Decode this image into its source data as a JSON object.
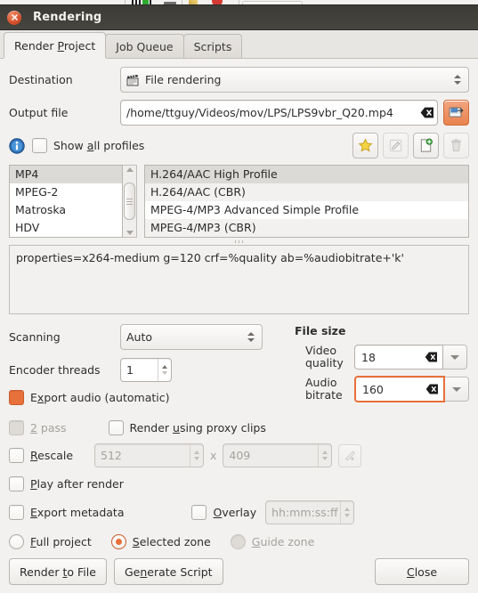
{
  "window": {
    "title": "Rendering",
    "close_icon": "close-icon"
  },
  "tabs": [
    {
      "label": "Render Project",
      "mnemonic": "P",
      "active": true
    },
    {
      "label": "Job Queue",
      "mnemonic": "J",
      "active": false
    },
    {
      "label": "Scripts",
      "mnemonic": "",
      "active": false
    }
  ],
  "destination": {
    "label": "Destination",
    "icon": "clapperboard-icon",
    "value": "File rendering"
  },
  "output_file": {
    "label": "Output file",
    "value": "/home/ttguy/Videos/mov/LPS/LPS9vbr_Q20.mp4",
    "clear_icon": "clear-entry-icon",
    "browse_icon": "open-folder-icon"
  },
  "profiles_bar": {
    "info_icon": "info-icon",
    "show_all_label": "Show all profiles",
    "show_all_mnemonic": "a",
    "show_all_checked": false,
    "actions": [
      {
        "name": "favorite-profile-button",
        "icon": "star-icon",
        "enabled": true
      },
      {
        "name": "edit-profile-button",
        "icon": "pencil-icon",
        "enabled": false
      },
      {
        "name": "new-profile-button",
        "icon": "new-document-plus-icon",
        "enabled": true
      },
      {
        "name": "delete-profile-button",
        "icon": "trash-icon",
        "enabled": false
      }
    ]
  },
  "format_list": {
    "items": [
      "MP4",
      "MPEG-2",
      "Matroska",
      "HDV"
    ],
    "selected_index": 0
  },
  "profile_list": {
    "items": [
      "H.264/AAC High Profile",
      "H.264/AAC (CBR)",
      "MPEG-4/MP3 Advanced Simple Profile",
      "MPEG-4/MP3 (CBR)"
    ],
    "selected_index": 0
  },
  "properties": {
    "text": "properties=x264-medium g=120 crf=%quality ab=%audiobitrate+'k'"
  },
  "scanning": {
    "label": "Scanning",
    "value": "Auto"
  },
  "encoder_threads": {
    "label": "Encoder threads",
    "value": "1"
  },
  "file_size": {
    "title": "File size",
    "video_quality": {
      "label_line1": "Video",
      "label_line2": "quality",
      "value": "18",
      "focused": false,
      "clear_icon": "clear-entry-icon",
      "dropdown_icon": "chevron-down-icon"
    },
    "audio_bitrate": {
      "label_line1": "Audio",
      "label_line2": "bitrate",
      "value": "160",
      "focused": true,
      "clear_icon": "clear-entry-icon",
      "dropdown_icon": "chevron-down-icon"
    }
  },
  "options": {
    "export_audio": {
      "label": "Export audio (automatic)",
      "mnemonic": "x",
      "state": "filled",
      "enabled": true
    },
    "two_pass": {
      "label": "2 pass",
      "mnemonic": "2",
      "checked": false,
      "enabled": false
    },
    "proxy_clips": {
      "label": "Render using proxy clips",
      "mnemonic": "u",
      "checked": false,
      "enabled": true
    },
    "rescale": {
      "label": "Rescale",
      "mnemonic": "R",
      "checked": false,
      "width": "512",
      "separator": "x",
      "height": "409",
      "enabled": false,
      "link_icon": "rescale-link-icon"
    },
    "play_after_render": {
      "label": "Play after render",
      "mnemonic": "P",
      "checked": false
    },
    "export_metadata": {
      "label": "Export metadata",
      "mnemonic": "E",
      "checked": false
    },
    "overlay": {
      "label": "Overlay",
      "mnemonic": "O",
      "checked": false,
      "timecode_placeholder": "hh:mm:ss:ff"
    }
  },
  "zone": {
    "full_project": {
      "label": "Full project",
      "mnemonic": "F",
      "selected": false,
      "enabled": true
    },
    "selected_zone": {
      "label": "Selected zone",
      "mnemonic": "S",
      "selected": true,
      "enabled": true
    },
    "guide_zone": {
      "label": "Guide zone",
      "mnemonic": "G",
      "selected": false,
      "enabled": false
    }
  },
  "footer": {
    "render_to_file": {
      "label": "Render to File",
      "mnemonic": "t"
    },
    "generate_script": {
      "label": "Generate Script",
      "mnemonic": "n"
    },
    "close": {
      "label": "Close",
      "mnemonic": "C"
    }
  },
  "colors": {
    "accent": "#e8703a",
    "titlebar": "#3f3e39",
    "window_bg": "#f2f1f0",
    "selection": "#dcdad7"
  }
}
